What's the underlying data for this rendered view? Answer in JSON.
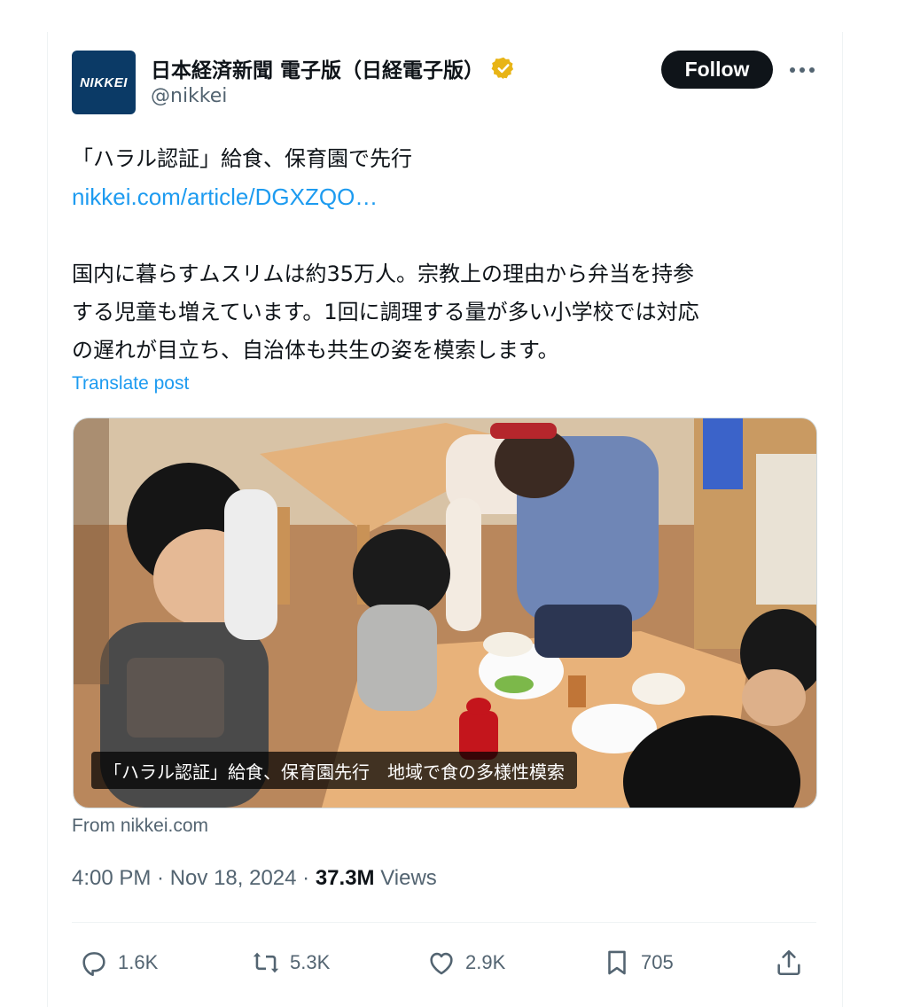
{
  "author": {
    "avatar_text": "NIKKEI",
    "name": "日本経済新聞 電子版（日経電子版）",
    "handle": "@nikkei",
    "verified_icon": "verified-badge-icon",
    "badge_color": "#e8b416"
  },
  "header": {
    "follow_label": "Follow",
    "more_icon": "more-icon"
  },
  "tweet": {
    "headline": "「ハラル認証」給食、保育園で先行",
    "link": "nikkei.com/article/DGXZQO…",
    "body_lines": [
      "国内に暮らすムスリムは約35万人。宗教上の理由から弁当を持参",
      "する児童も増えています。1回に調理する量が多い小学校では対応",
      "の遅れが目立ち、自治体も共生の姿を模索します。"
    ],
    "translate_label": "Translate post"
  },
  "media": {
    "caption": "「ハラル認証」給食、保育園先行　地域で食の多様性模索",
    "source": "From nikkei.com"
  },
  "meta": {
    "time": "4:00 PM",
    "date": "Nov 18, 2024",
    "views_count": "37.3M",
    "views_label": "Views"
  },
  "actions": {
    "replies": "1.6K",
    "reposts": "5.3K",
    "likes": "2.9K",
    "bookmarks": "705"
  },
  "colors": {
    "accent": "#1d9bf0",
    "muted": "#536471",
    "brand": "#0b3a66"
  }
}
